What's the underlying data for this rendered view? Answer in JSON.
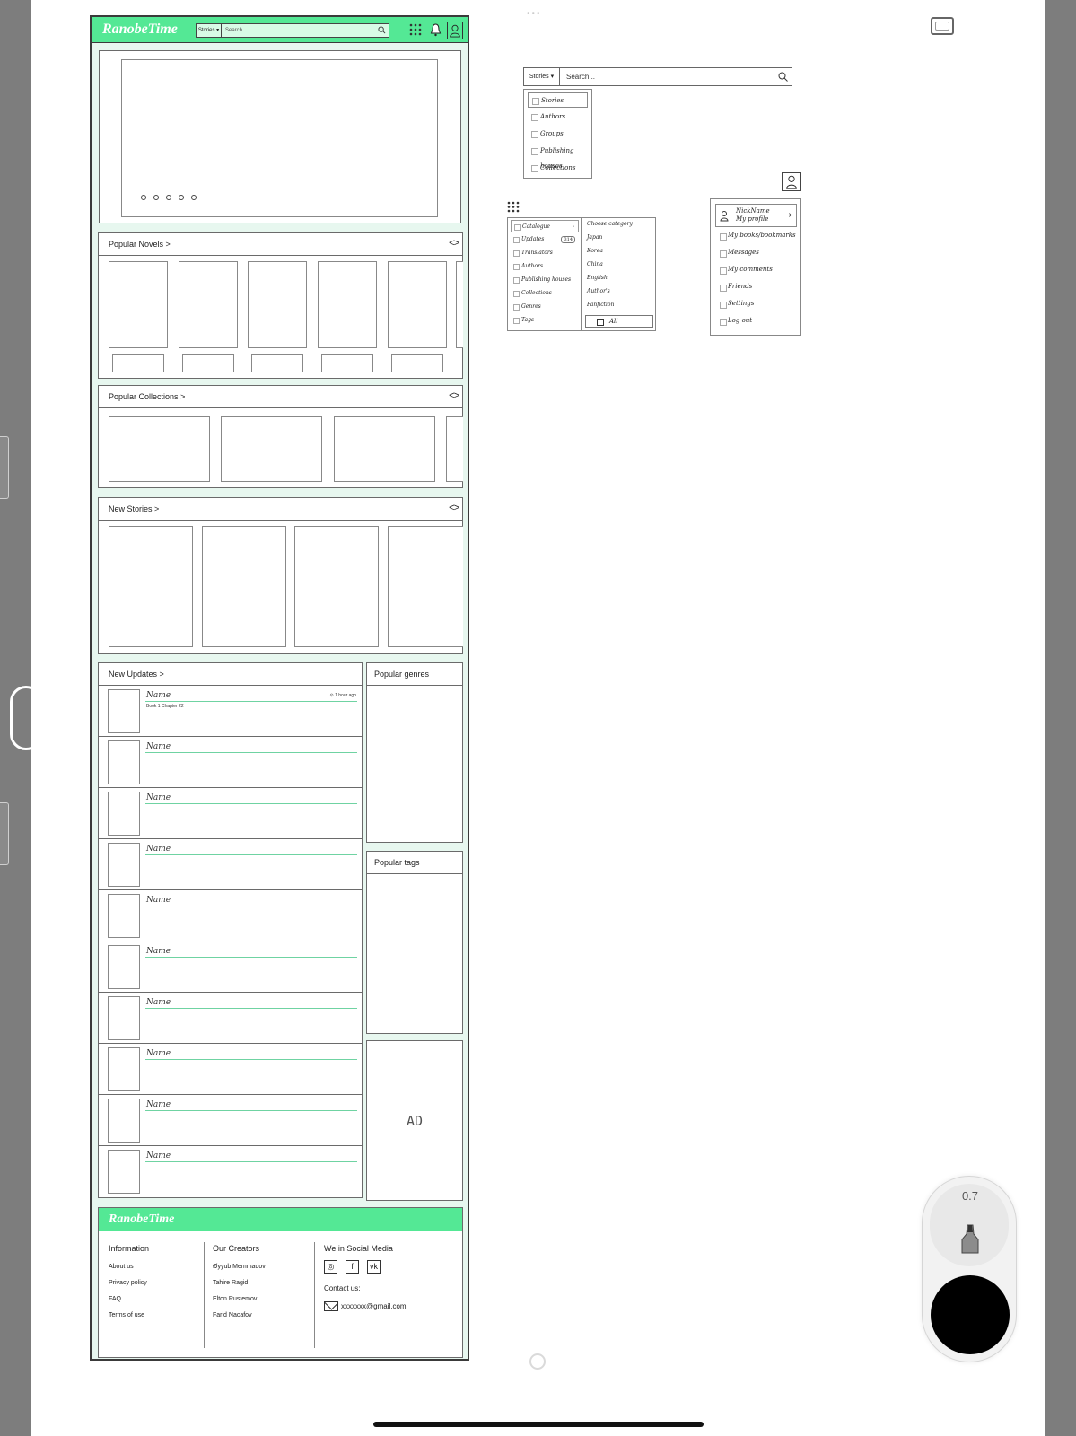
{
  "pen": {
    "value": "0.7"
  },
  "header": {
    "logo": "RanobeTime",
    "search_category": "Stories ▾",
    "search_placeholder": "Search"
  },
  "sections": {
    "popular_novels": "Popular Novels",
    "popular_collections": "Popular Collections",
    "new_stories": "New Stories",
    "new_updates": "New Updates",
    "popular_genres": "Popular genres",
    "popular_tags": "Popular tags",
    "ad": "AD",
    "arrows": "<>",
    "chevron": ">"
  },
  "updates": [
    {
      "name": "Name",
      "time": "⊙ 1 hour ago",
      "chapter": "Book 1 Chapter 22"
    },
    {
      "name": "Name"
    },
    {
      "name": "Name"
    },
    {
      "name": "Name"
    },
    {
      "name": "Name"
    },
    {
      "name": "Name"
    },
    {
      "name": "Name"
    },
    {
      "name": "Name"
    },
    {
      "name": "Name"
    },
    {
      "name": "Name"
    }
  ],
  "footer": {
    "logo": "RanobeTime",
    "info_title": "Information",
    "info_links": [
      "About us",
      "Privacy policy",
      "FAQ",
      "Terms of use"
    ],
    "creators_title": "Our Creators",
    "creators": [
      "Øyyub Memmadov",
      "Tahire Ragid",
      "Elton Rustemov",
      "Farid Nacafov"
    ],
    "social_title": "We in Social Media",
    "socials": [
      "◎",
      "f",
      "vk"
    ],
    "contact_title": "Contact us:",
    "email": "xxxxxxx@gmail.com"
  },
  "sketch_search": {
    "category": "Stories ▾",
    "placeholder": "Search...",
    "options": [
      "Stories",
      "Authors",
      "Groups",
      "Publishing houses",
      "Collections"
    ]
  },
  "sketch_menu": {
    "items": [
      "Catalogue",
      "Updates",
      "Translators",
      "Authors",
      "Publishing houses",
      "Collections",
      "Genres",
      "Tags"
    ],
    "updates_badge": "314",
    "submenu_title": "Choose category",
    "submenu": [
      "Japan",
      "Korea",
      "China",
      "English",
      "Author's",
      "Fanfiction"
    ],
    "all_label": "All"
  },
  "sketch_profile": {
    "nickname": "NickName",
    "my_profile": "My profile",
    "items": [
      "My books/bookmarks",
      "Messages",
      "My comments",
      "Friends",
      "Settings",
      "Log out"
    ]
  }
}
